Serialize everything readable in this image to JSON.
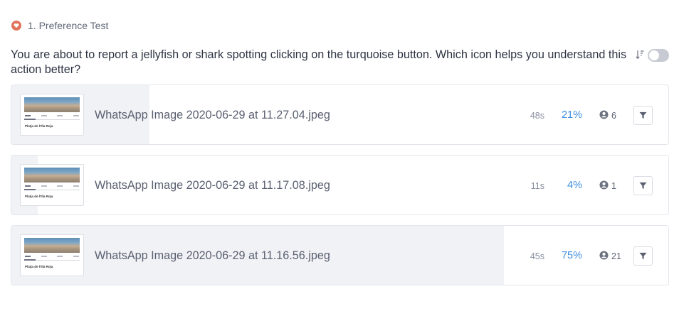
{
  "test": {
    "title": "1. Preference Test",
    "question": "You are about to report a jellyfish or shark spotting clicking on the turquoise button. Which icon helps you understand this action better?"
  },
  "controls": {
    "sort_icon": "sort-descending-icon",
    "toggle_on": false
  },
  "colors": {
    "accent": "#3d8ee0",
    "badge": "#e0735a",
    "fill": "#f1f2f6"
  },
  "results": [
    {
      "file_name": "WhatsApp Image 2020-06-29 at 11.27.04.jpeg",
      "time": "48s",
      "percent": "21%",
      "share": 0.21,
      "users": "6",
      "thumb_caption": "Platja de l'Illa Roja"
    },
    {
      "file_name": "WhatsApp Image 2020-06-29 at 11.17.08.jpeg",
      "time": "11s",
      "percent": "4%",
      "share": 0.04,
      "users": "1",
      "thumb_caption": "Platja de l'Illa Roja"
    },
    {
      "file_name": "WhatsApp Image 2020-06-29 at 11.16.56.jpeg",
      "time": "45s",
      "percent": "75%",
      "share": 0.75,
      "users": "21",
      "thumb_caption": "Platja de l'Illa Roja"
    }
  ]
}
